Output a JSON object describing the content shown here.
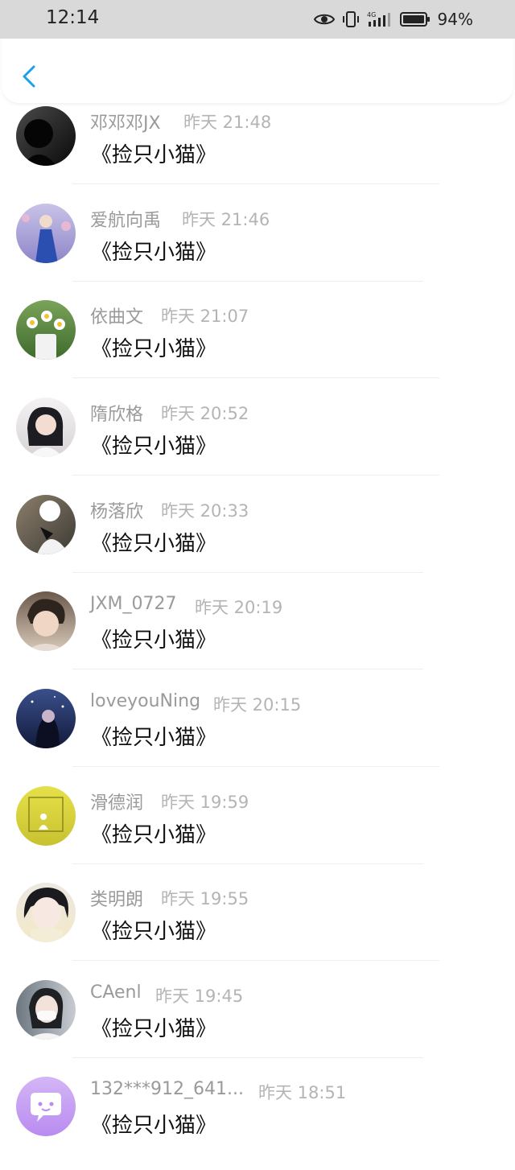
{
  "status": {
    "time": "12:14",
    "battery": "94%",
    "icons": [
      "eye-icon",
      "vibrate-icon",
      "signal-4g-icon",
      "battery-icon"
    ]
  },
  "nav": {
    "back_icon": "chevron-left-icon"
  },
  "colors": {
    "accent": "#1aa1e6",
    "name": "#9a9a9a",
    "time": "#b4b4b4",
    "content": "#111111"
  },
  "comments": [
    {
      "name": "邓邓邓JX",
      "time": "昨天 21:48",
      "content": "《捡只小猫》",
      "avatar": "dark-silhouette"
    },
    {
      "name": "爱航向禹",
      "time": "昨天 21:46",
      "content": "《捡只小猫》",
      "avatar": "blue-hanfu"
    },
    {
      "name": "依曲文",
      "time": "昨天 21:07",
      "content": "《捡只小猫》",
      "avatar": "daisy-vase"
    },
    {
      "name": "隋欣格",
      "time": "昨天 20:52",
      "content": "《捡只小猫》",
      "avatar": "girl-white"
    },
    {
      "name": "杨落欣",
      "time": "昨天 20:33",
      "content": "《捡只小猫》",
      "avatar": "girl-blackhat"
    },
    {
      "name": "JXM_0727",
      "time": "昨天 20:19",
      "content": "《捡只小猫》",
      "avatar": "boy-portrait"
    },
    {
      "name": "loveyouNing",
      "time": "昨天 20:15",
      "content": "《捡只小猫》",
      "avatar": "night-girl"
    },
    {
      "name": "滑德润",
      "time": "昨天 19:59",
      "content": "《捡只小猫》",
      "avatar": "yellow-frame"
    },
    {
      "name": "类明朗",
      "time": "昨天 19:55",
      "content": "《捡只小猫》",
      "avatar": "girl-bangs"
    },
    {
      "name": "CAenl",
      "time": "昨天 19:45",
      "content": "《捡只小猫》",
      "avatar": "mask-girl"
    },
    {
      "name": "132***912_641...",
      "time": "昨天 18:51",
      "content": "《捡只小猫》",
      "avatar": "default-purple"
    }
  ]
}
